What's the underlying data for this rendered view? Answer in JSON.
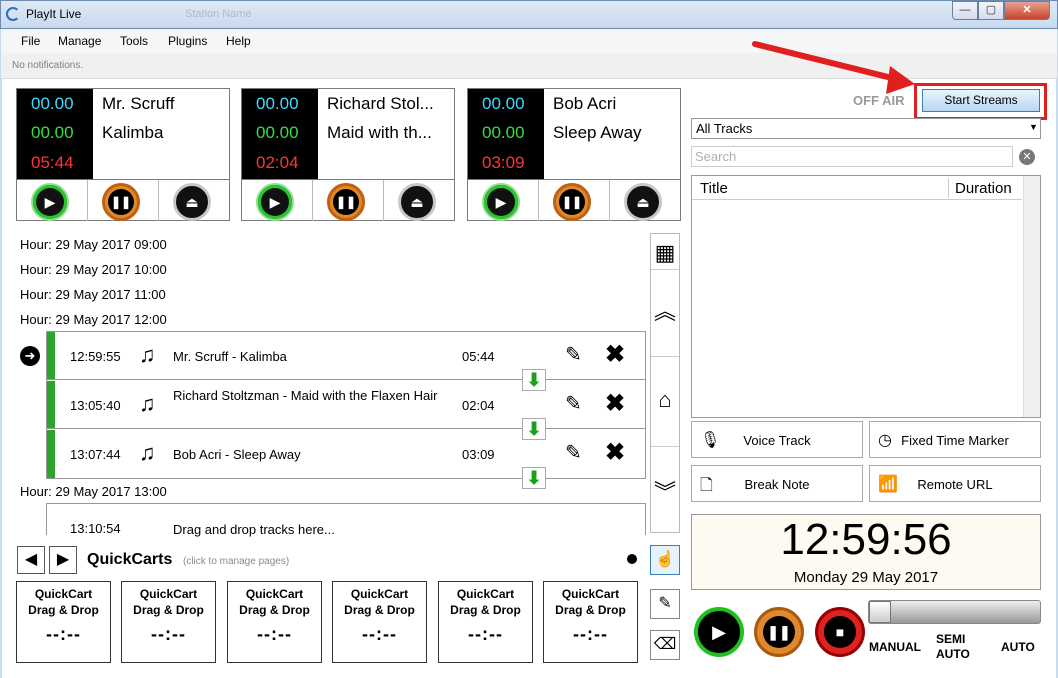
{
  "window": {
    "title": "PlayIt Live",
    "faded_title": "Station Name",
    "min": "—",
    "max": "▢",
    "close": "✕"
  },
  "menu": [
    "File",
    "Manage",
    "Tools",
    "Plugins",
    "Help"
  ],
  "notifications": "No notifications.",
  "players": [
    {
      "elapsed": "00.00",
      "intro": "00.00",
      "remaining": "05:44",
      "artist": "Mr. Scruff",
      "title": "Kalimba"
    },
    {
      "elapsed": "00.00",
      "intro": "00.00",
      "remaining": "02:04",
      "artist": "Richard Stol...",
      "title": "Maid with th..."
    },
    {
      "elapsed": "00.00",
      "intro": "00.00",
      "remaining": "03:09",
      "artist": "Bob Acri",
      "title": "Sleep Away"
    }
  ],
  "playlist": {
    "hours": [
      "Hour: 29 May 2017 09:00",
      "Hour: 29 May 2017 10:00",
      "Hour: 29 May 2017 11:00",
      "Hour: 29 May 2017 12:00",
      "Hour: 29 May 2017 13:00"
    ],
    "items": [
      {
        "time": "12:59:55",
        "title": "Mr. Scruff - Kalimba",
        "duration": "05:44"
      },
      {
        "time": "13:05:40",
        "title": "Richard Stoltzman - Maid with the Flaxen Hair",
        "duration": "02:04"
      },
      {
        "time": "13:07:44",
        "title": "Bob Acri - Sleep Away",
        "duration": "03:09"
      }
    ],
    "next_hour_item": {
      "time": "13:10:54",
      "title": "Drag and drop tracks here..."
    }
  },
  "quickcarts": {
    "title": "QuickCarts",
    "hint": "(click to manage pages)",
    "carts": [
      {
        "l1": "QuickCart",
        "l2": "Drag & Drop",
        "time": "--:--"
      },
      {
        "l1": "QuickCart",
        "l2": "Drag & Drop",
        "time": "--:--"
      },
      {
        "l1": "QuickCart",
        "l2": "Drag & Drop",
        "time": "--:--"
      },
      {
        "l1": "QuickCart",
        "l2": "Drag & Drop",
        "time": "--:--"
      },
      {
        "l1": "QuickCart",
        "l2": "Drag & Drop",
        "time": "--:--"
      },
      {
        "l1": "QuickCart",
        "l2": "Drag & Drop",
        "time": "--:--"
      }
    ]
  },
  "stream": {
    "status": "OFF AIR",
    "button": "Start Streams"
  },
  "library": {
    "filter": "All Tracks",
    "search_placeholder": "Search",
    "col_title": "Title",
    "col_duration": "Duration"
  },
  "actions": {
    "voice_track": "Voice Track",
    "fixed_time": "Fixed Time Marker",
    "break_note": "Break Note",
    "remote_url": "Remote URL"
  },
  "clock": {
    "time": "12:59:56",
    "date": "Monday 29 May 2017"
  },
  "modes": {
    "manual": "MANUAL",
    "semi": "SEMI",
    "semi2": "AUTO",
    "auto": "AUTO"
  },
  "colors": {
    "highlight": "#e0201e",
    "elapsed": "#40d8ff",
    "intro": "#2fe23e",
    "remaining": "#ff3333",
    "row_bar": "#2da52d"
  }
}
